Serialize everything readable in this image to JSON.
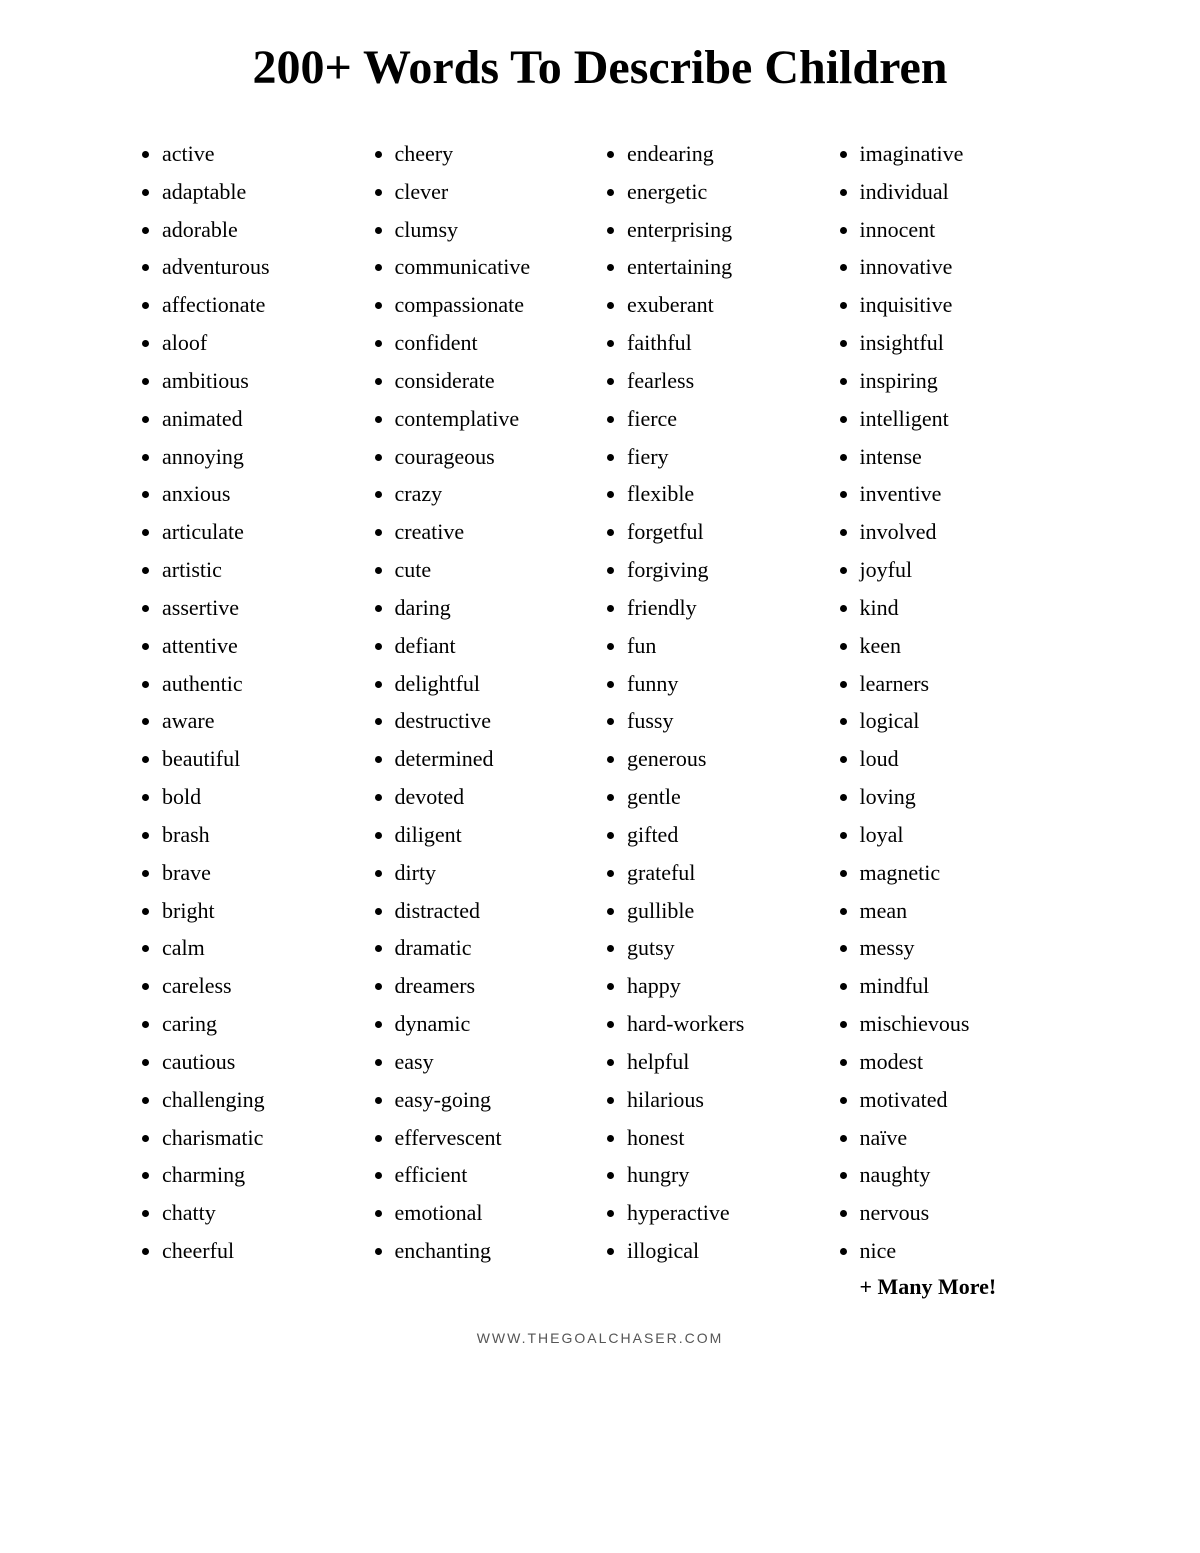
{
  "title": "200+ Words To Describe Children",
  "footer": "WWW.THEGOALCHASER.COM",
  "more_label": "+ Many More!",
  "columns": [
    {
      "id": "col1",
      "words": [
        "active",
        "adaptable",
        "adorable",
        "adventurous",
        "affectionate",
        "aloof",
        "ambitious",
        "animated",
        "annoying",
        "anxious",
        "articulate",
        "artistic",
        "assertive",
        "attentive",
        "authentic",
        "aware",
        "beautiful",
        "bold",
        "brash",
        "brave",
        "bright",
        "calm",
        "careless",
        "caring",
        "cautious",
        "challenging",
        "charismatic",
        "charming",
        "chatty",
        "cheerful"
      ]
    },
    {
      "id": "col2",
      "words": [
        "cheery",
        "clever",
        "clumsy",
        "communicative",
        "compassionate",
        "confident",
        "considerate",
        "contemplative",
        "courageous",
        "crazy",
        "creative",
        "cute",
        "daring",
        "defiant",
        "delightful",
        "destructive",
        "determined",
        "devoted",
        "diligent",
        "dirty",
        "distracted",
        "dramatic",
        "dreamers",
        "dynamic",
        "easy",
        "easy-going",
        "effervescent",
        "efficient",
        "emotional",
        "enchanting"
      ]
    },
    {
      "id": "col3",
      "words": [
        "endearing",
        "energetic",
        "enterprising",
        "entertaining",
        "exuberant",
        "faithful",
        "fearless",
        "fierce",
        "fiery",
        "flexible",
        "forgetful",
        "forgiving",
        "friendly",
        "fun",
        "funny",
        "fussy",
        "generous",
        "gentle",
        "gifted",
        "grateful",
        "gullible",
        "gutsy",
        "happy",
        "hard-workers",
        "helpful",
        "hilarious",
        "honest",
        "hungry",
        "hyperactive",
        "illogical"
      ]
    },
    {
      "id": "col4",
      "words": [
        "imaginative",
        "individual",
        "innocent",
        "innovative",
        "inquisitive",
        "insightful",
        "inspiring",
        "intelligent",
        "intense",
        "inventive",
        "involved",
        "joyful",
        "kind",
        "keen",
        "learners",
        "logical",
        "loud",
        "loving",
        "loyal",
        "magnetic",
        "mean",
        "messy",
        "mindful",
        "mischievous",
        "modest",
        "motivated",
        "naïve",
        "naughty",
        "nervous",
        "nice"
      ]
    }
  ]
}
